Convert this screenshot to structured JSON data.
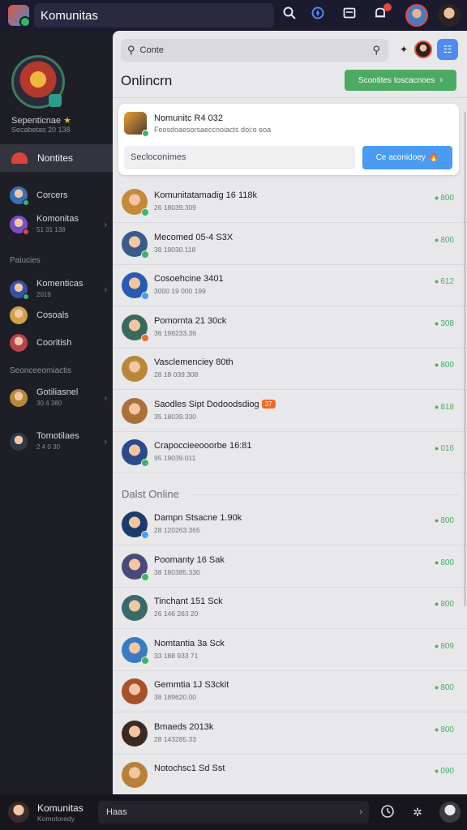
{
  "topbar": {
    "title": "Komunitas",
    "icons": [
      "search-icon",
      "compass-icon",
      "inbox-icon",
      "bell-icon"
    ],
    "notification_color": "#e4473c"
  },
  "sidebar": {
    "profile_name": "Sepenticnae",
    "profile_sub": "Secabetas 20 138",
    "active_item": "Nontites",
    "items_top": [
      {
        "label": "Corcers",
        "sub": "",
        "color": "#3a6fb5",
        "dot": "#3cb56c",
        "chevron": false
      },
      {
        "label": "Komonitas",
        "sub": "51 31 138",
        "color": "#7a4fc2",
        "dot": "#e4473c",
        "chevron": true
      }
    ],
    "section_1": "Paiucies",
    "items_mid": [
      {
        "label": "Komenticas",
        "sub": "2019",
        "color": "#3a4fa8",
        "dot": "#3cb56c",
        "chevron": true
      },
      {
        "label": "Cosoals",
        "sub": "",
        "color": "#d1a04a",
        "dot": "",
        "chevron": false
      },
      {
        "label": "Cooritish",
        "sub": "",
        "color": "#b7444e",
        "dot": "",
        "chevron": false
      }
    ],
    "section_2": "Seonceeomiactis",
    "items_bottom": [
      {
        "label": "Gotiliasnel",
        "sub": "30 4 380",
        "color": "#b8893a",
        "dot": "",
        "chevron": true
      },
      {
        "label": "Tomotilaes",
        "sub": "2 4 0 30",
        "color": "#2e3a4a",
        "dot": "",
        "chevron": true
      }
    ]
  },
  "main": {
    "search_text": "Conte",
    "page_title": "Onlincrn",
    "green_button": "Scontites toscacnoes",
    "card": {
      "title": "Nomunitc R4 032",
      "subtitle": "Feosdoaesorsaeccnoiacts doi:o eoa",
      "input_placeholder": "Secloconimes",
      "button_label": "Ce aconidoey"
    },
    "rows_online": [
      {
        "name": "Komunitatamadig 16 118k",
        "meta": "26 18039.309",
        "count": "800",
        "color": "#c48a3a",
        "dot": "#3cb56c"
      },
      {
        "name": "Mecomed 05-4 S3X",
        "meta": "38 19030.118",
        "count": "800",
        "color": "#3a5a8a",
        "dot": "#3cb56c"
      },
      {
        "name": "Cosoehcine 3401",
        "meta": "3000 19 000 199",
        "count": "612",
        "color": "#2a5ab0",
        "dot": "#4b9bf2"
      },
      {
        "name": "Pomornta 21 30ck",
        "meta": "36 198233.36",
        "count": "308",
        "color": "#3c6a5a",
        "dot": "#ef6a2a"
      },
      {
        "name": "Vasclemenciey 80th",
        "meta": "28 18 039.308",
        "count": "800",
        "color": "#b8873a",
        "dot": ""
      },
      {
        "name": "Saodles Sipt Dodoodsdiog",
        "meta": "35 18039.330",
        "count": "818",
        "color": "#a8703a",
        "dot": "",
        "tag": "37"
      },
      {
        "name": "Crapoccieeooorbe 16:81",
        "meta": "95 19039.011",
        "count": "016",
        "color": "#2a4a8a",
        "dot": "#3cb56c"
      }
    ],
    "section_label": "Dalst Online",
    "rows_offline": [
      {
        "name": "Dampn Stsacne 1.90k",
        "meta": "28 120263.365",
        "count": "800",
        "color": "#1e3a6a",
        "dot": "#4b9bf2"
      },
      {
        "name": "Poomanty 16 Sak",
        "meta": "38 180385.330",
        "count": "800",
        "color": "#4a4a7a",
        "dot": "#3cb56c"
      },
      {
        "name": "Tinchant 151 Sck",
        "meta": "26 146 263 20",
        "count": "800",
        "color": "#3a6a6a",
        "dot": ""
      },
      {
        "name": "Nomtantia 3a Sck",
        "meta": "33 188 933 71",
        "count": "809",
        "color": "#3a7ac0",
        "dot": "#3cb56c"
      },
      {
        "name": "Gemmtia 1J S3ckit",
        "meta": "38 189620.00",
        "count": "800",
        "color": "#a8502a",
        "dot": ""
      },
      {
        "name": "Bmaeds 2013k",
        "meta": "28 143285.33",
        "count": "800",
        "color": "#3a2a22",
        "dot": ""
      },
      {
        "name": "Notochsc1 Sd Sst",
        "meta": "",
        "count": "090",
        "color": "#b8803a",
        "dot": ""
      }
    ]
  },
  "bottombar": {
    "name": "Komunitas",
    "sub": "Komotoredy",
    "input_text": "Haas"
  }
}
